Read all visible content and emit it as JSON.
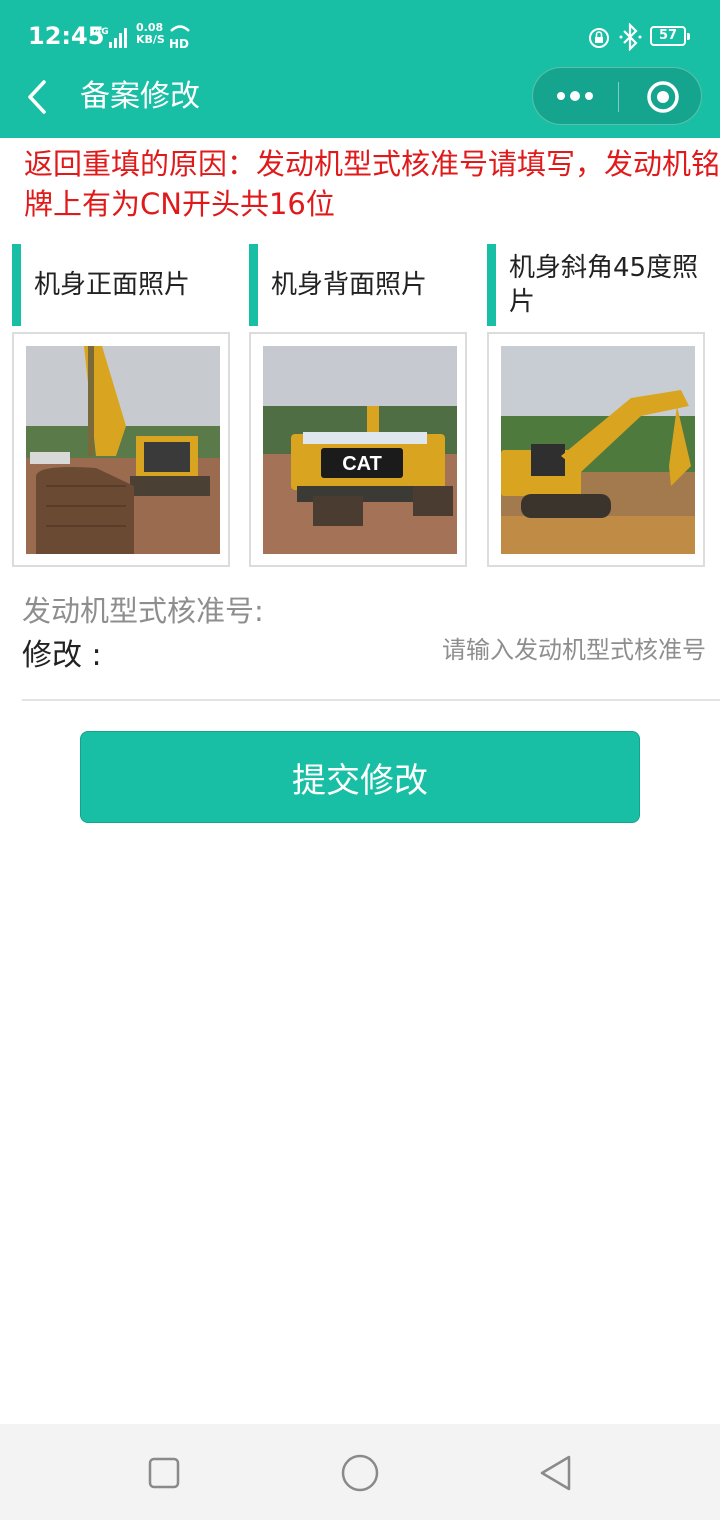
{
  "status_bar": {
    "time": "12:45",
    "network_icon": "signal-4g-icon",
    "speed_value": "0.08",
    "speed_unit": "KB/S",
    "hd_icon": "hd-call-icon",
    "lock_icon": "rotation-lock-icon",
    "bluetooth_icon": "bluetooth-icon",
    "battery": "57"
  },
  "header": {
    "title": "备案修改",
    "back_icon": "chevron-left-icon",
    "more_icon": "more-dots-icon",
    "close_icon": "target-close-icon",
    "background": "#19bfa5"
  },
  "notice": {
    "text": "返回重填的原因：发动机型式核准号请填写，发动机铭牌上有为CN开头共16位",
    "color": "#e01a1a"
  },
  "photos": [
    {
      "label": "机身正面照片",
      "subject": "excavator front view"
    },
    {
      "label": "机身背面照片",
      "subject": "excavator rear view"
    },
    {
      "label": "机身斜角45度照片",
      "subject": "excavator 45 degree view"
    }
  ],
  "form": {
    "field_label": "发动机型式核准号:",
    "edit_label": "修改 :",
    "edit_placeholder": "请输入发动机型式核准号",
    "edit_value": ""
  },
  "submit_label": "提交修改",
  "nav": {
    "recent_icon": "square-recent-icon",
    "home_icon": "circle-home-icon",
    "back_icon": "triangle-back-icon"
  },
  "colors": {
    "accent": "#19bfa5",
    "error": "#e01a1a",
    "muted_text": "#8e8e8e"
  }
}
